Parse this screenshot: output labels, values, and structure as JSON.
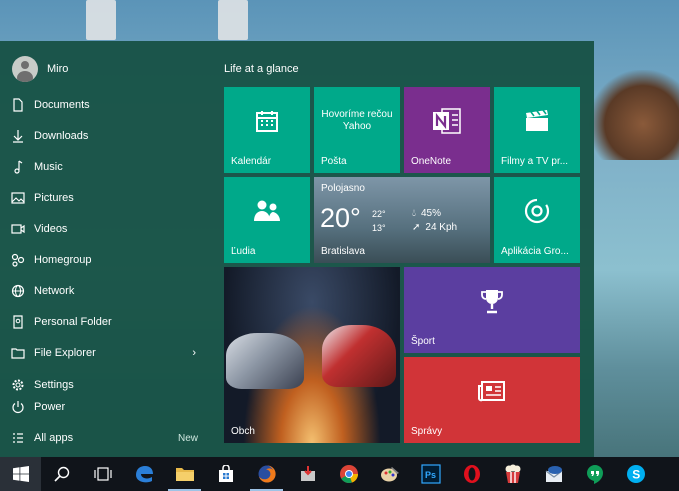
{
  "user": {
    "name": "Miro"
  },
  "nav_items": [
    {
      "label": "Documents",
      "icon": "document-icon"
    },
    {
      "label": "Downloads",
      "icon": "download-icon"
    },
    {
      "label": "Music",
      "icon": "music-icon"
    },
    {
      "label": "Pictures",
      "icon": "pictures-icon"
    },
    {
      "label": "Videos",
      "icon": "video-icon"
    },
    {
      "label": "Homegroup",
      "icon": "homegroup-icon"
    },
    {
      "label": "Network",
      "icon": "network-icon"
    },
    {
      "label": "Personal Folder",
      "icon": "folder-icon"
    },
    {
      "label": "File Explorer",
      "icon": "file-explorer-icon"
    },
    {
      "label": "Settings",
      "icon": "gear-icon"
    },
    {
      "label": "Power",
      "icon": "power-icon"
    },
    {
      "label": "All apps",
      "icon": "all-apps-icon",
      "badge": "New"
    }
  ],
  "tiles": {
    "group_title": "Life at a glance",
    "calendar": "Kalendár",
    "mail_top": "Hovoríme rečou",
    "mail_top2": "Yahoo",
    "mail": "Pošta",
    "onenote": "OneNote",
    "movies": "Filmy a TV pr...",
    "people": "Ľudia",
    "groove": "Aplikácia Gro...",
    "sport": "Šport",
    "news": "Správy",
    "store": "Obch",
    "weather": {
      "condition": "Polojasno",
      "temp": "20°",
      "high": "22°",
      "low": "13°",
      "humidity": "45%",
      "wind": "24 Kph",
      "city": "Bratislava"
    }
  },
  "colors": {
    "tile_teal": "#00a98a",
    "onenote": "#7a2e8e",
    "sport": "#5b3ea0",
    "news": "#d13438",
    "start_bg": "#185246"
  },
  "taskbar": [
    "start-button",
    "search-button",
    "task-view-button",
    "edge",
    "file-explorer",
    "store",
    "firefox",
    "installer",
    "chrome",
    "paint",
    "photoshop",
    "opera",
    "popcorn",
    "thunderbird",
    "hangouts",
    "skype"
  ]
}
